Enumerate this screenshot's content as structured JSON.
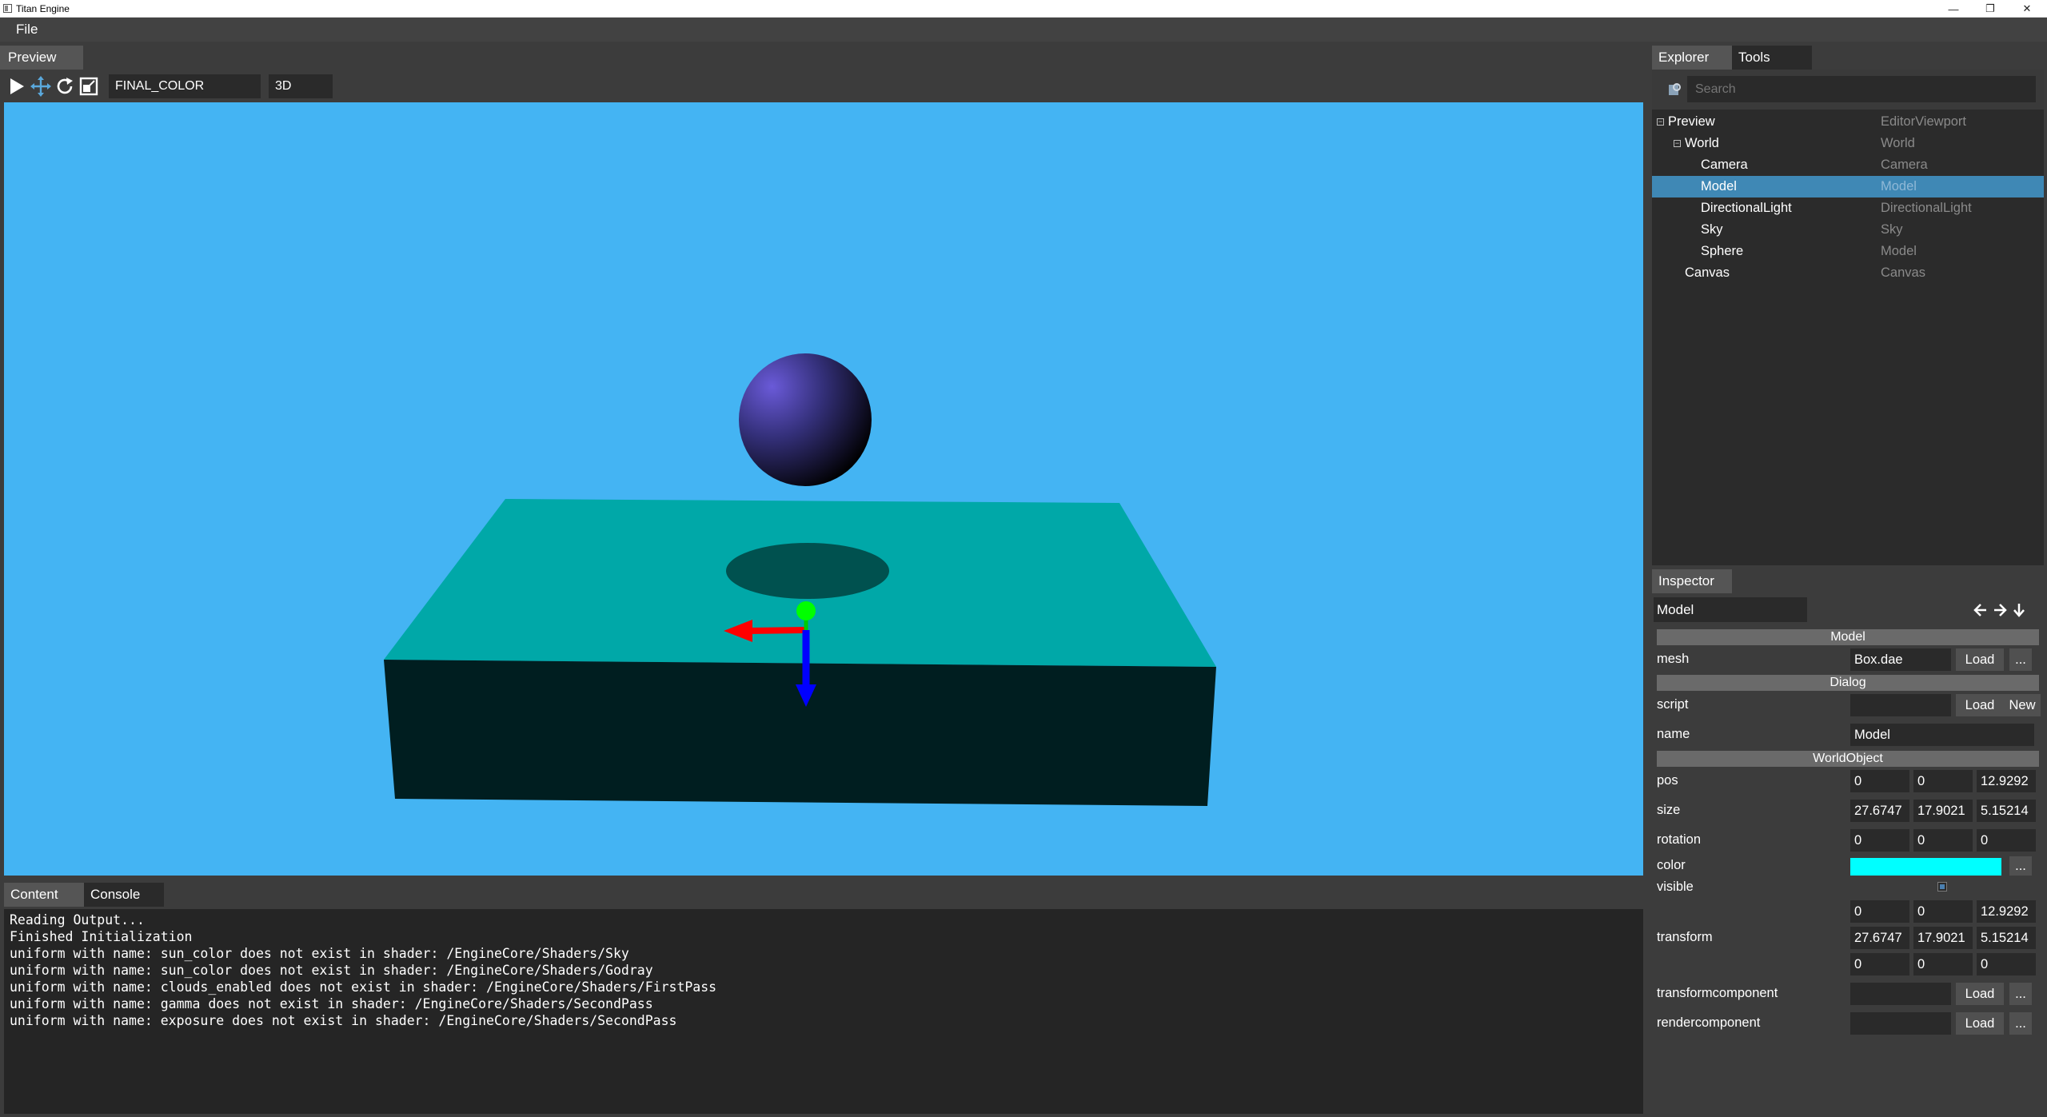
{
  "window": {
    "title": "Titan Engine",
    "controls": {
      "minimize": "—",
      "restore": "❐",
      "close": "✕"
    }
  },
  "menu": {
    "items": [
      "File"
    ]
  },
  "preview": {
    "tab_label": "Preview",
    "toolbar": {
      "icons": [
        "play-icon",
        "move-icon",
        "rotate-icon",
        "scale-icon"
      ],
      "render_mode": "FINAL_COLOR",
      "dimension": "3D"
    },
    "viewport_bg": "#44b4f3"
  },
  "bottom": {
    "tabs": [
      "Content",
      "Console"
    ],
    "active_tab": "Console",
    "console_lines": [
      "Reading Output...",
      "Finished Initialization",
      "uniform with name: sun_color does not exist in shader: /EngineCore/Shaders/Sky",
      "uniform with name: sun_color does not exist in shader: /EngineCore/Shaders/Godray",
      "uniform with name: clouds_enabled does not exist in shader: /EngineCore/Shaders/FirstPass",
      "uniform with name: gamma does not exist in shader: /EngineCore/Shaders/SecondPass",
      "uniform with name: exposure does not exist in shader: /EngineCore/Shaders/SecondPass"
    ]
  },
  "explorer": {
    "tabs": [
      "Explorer",
      "Tools"
    ],
    "active_tab": "Explorer",
    "search_placeholder": "Search",
    "tree": [
      {
        "name": "Preview",
        "type": "EditorViewport",
        "depth": 0,
        "expander": "−"
      },
      {
        "name": "World",
        "type": "World",
        "depth": 1,
        "expander": "−"
      },
      {
        "name": "Camera",
        "type": "Camera",
        "depth": 2
      },
      {
        "name": "Model",
        "type": "Model",
        "depth": 2,
        "selected": true
      },
      {
        "name": "DirectionalLight",
        "type": "DirectionalLight",
        "depth": 2
      },
      {
        "name": "Sky",
        "type": "Sky",
        "depth": 2
      },
      {
        "name": "Sphere",
        "type": "Model",
        "depth": 2
      },
      {
        "name": "Canvas",
        "type": "Canvas",
        "depth": 1
      }
    ]
  },
  "inspector": {
    "tab_label": "Inspector",
    "object_name": "Model",
    "sections": {
      "model": "Model",
      "dialog": "Dialog",
      "world_object": "WorldObject"
    },
    "labels": {
      "mesh": "mesh",
      "script": "script",
      "name": "name",
      "pos": "pos",
      "size": "size",
      "rotation": "rotation",
      "color": "color",
      "visible": "visible",
      "transform": "transform",
      "transformcomponent": "transformcomponent",
      "rendercomponent": "rendercomponent"
    },
    "buttons": {
      "load": "Load",
      "new": "New",
      "more": "..."
    },
    "mesh": "Box.dae",
    "script": "",
    "name": "Model",
    "pos": [
      "0",
      "0",
      "12.9292"
    ],
    "size": [
      "27.6747",
      "17.9021",
      "5.15214"
    ],
    "rotation": [
      "0",
      "0",
      "0"
    ],
    "color": "#00ffff",
    "visible": true,
    "transform": [
      [
        "0",
        "0",
        "12.9292"
      ],
      [
        "27.6747",
        "17.9021",
        "5.15214"
      ],
      [
        "0",
        "0",
        "0"
      ]
    ],
    "transformcomponent": "",
    "rendercomponent": ""
  }
}
